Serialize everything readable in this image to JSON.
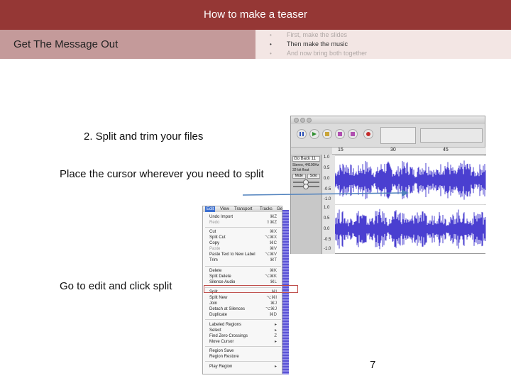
{
  "header": {
    "title": "How to make a teaser"
  },
  "section": {
    "label": "Get The Message Out",
    "bullets": [
      "First, make the slides",
      "Then make the music",
      "And now bring both together"
    ]
  },
  "content": {
    "step_title": "2. Split and trim your files",
    "cursor_note": "Place the cursor wherever you need to split",
    "edit_note": "Go to edit and click split"
  },
  "page_number": "7",
  "audacity": {
    "ruler_ticks": [
      "15",
      "30",
      "45"
    ],
    "track_name": "Go Back 11",
    "track_meta": [
      "Stereo, 44100Hz",
      "32-bit float"
    ],
    "mute_label": "Mute",
    "solo_label": "Solo",
    "scale_labels": [
      "1.0",
      "0.5",
      "0.0",
      "-0.5",
      "-1.0",
      "1.0",
      "0.5",
      "0.0",
      "-0.5",
      "-1.0"
    ],
    "wave_color": "#4a3fd0"
  },
  "edit_menu": {
    "menubar": [
      "Edit",
      "View",
      "Transport",
      "Tracks",
      "Ge"
    ],
    "items": [
      {
        "label": "Undo Import",
        "shortcut": "⌘Z"
      },
      {
        "label": "Redo",
        "shortcut": "⇧⌘Z",
        "disabled": true
      },
      {
        "label": "Cut",
        "shortcut": "⌘X"
      },
      {
        "label": "Split Cut",
        "shortcut": "⌥⌘X"
      },
      {
        "label": "Copy",
        "shortcut": "⌘C"
      },
      {
        "label": "Paste",
        "shortcut": "⌘V",
        "disabled": true
      },
      {
        "label": "Paste Text to New Label",
        "shortcut": "⌥⌘V"
      },
      {
        "label": "Trim",
        "shortcut": "⌘T"
      },
      {
        "label": "Delete",
        "shortcut": "⌘K"
      },
      {
        "label": "Split Delete",
        "shortcut": "⌥⌘K"
      },
      {
        "label": "Silence Audio",
        "shortcut": "⌘L"
      },
      {
        "label": "Split",
        "shortcut": "⌘I"
      },
      {
        "label": "Split New",
        "shortcut": "⌥⌘I"
      },
      {
        "label": "Join",
        "shortcut": "⌘J"
      },
      {
        "label": "Detach at Silences",
        "shortcut": "⌥⌘J"
      },
      {
        "label": "Duplicate",
        "shortcut": "⌘D"
      },
      {
        "label": "Labeled Regions",
        "shortcut": "▸"
      },
      {
        "label": "Select",
        "shortcut": "▸"
      },
      {
        "label": "Find Zero Crossings",
        "shortcut": "Z"
      },
      {
        "label": "Move Cursor",
        "shortcut": "▸"
      },
      {
        "label": "Region Save",
        "shortcut": ""
      },
      {
        "label": "Region Restore",
        "shortcut": ""
      },
      {
        "label": "Play Region",
        "shortcut": "▸"
      }
    ]
  }
}
